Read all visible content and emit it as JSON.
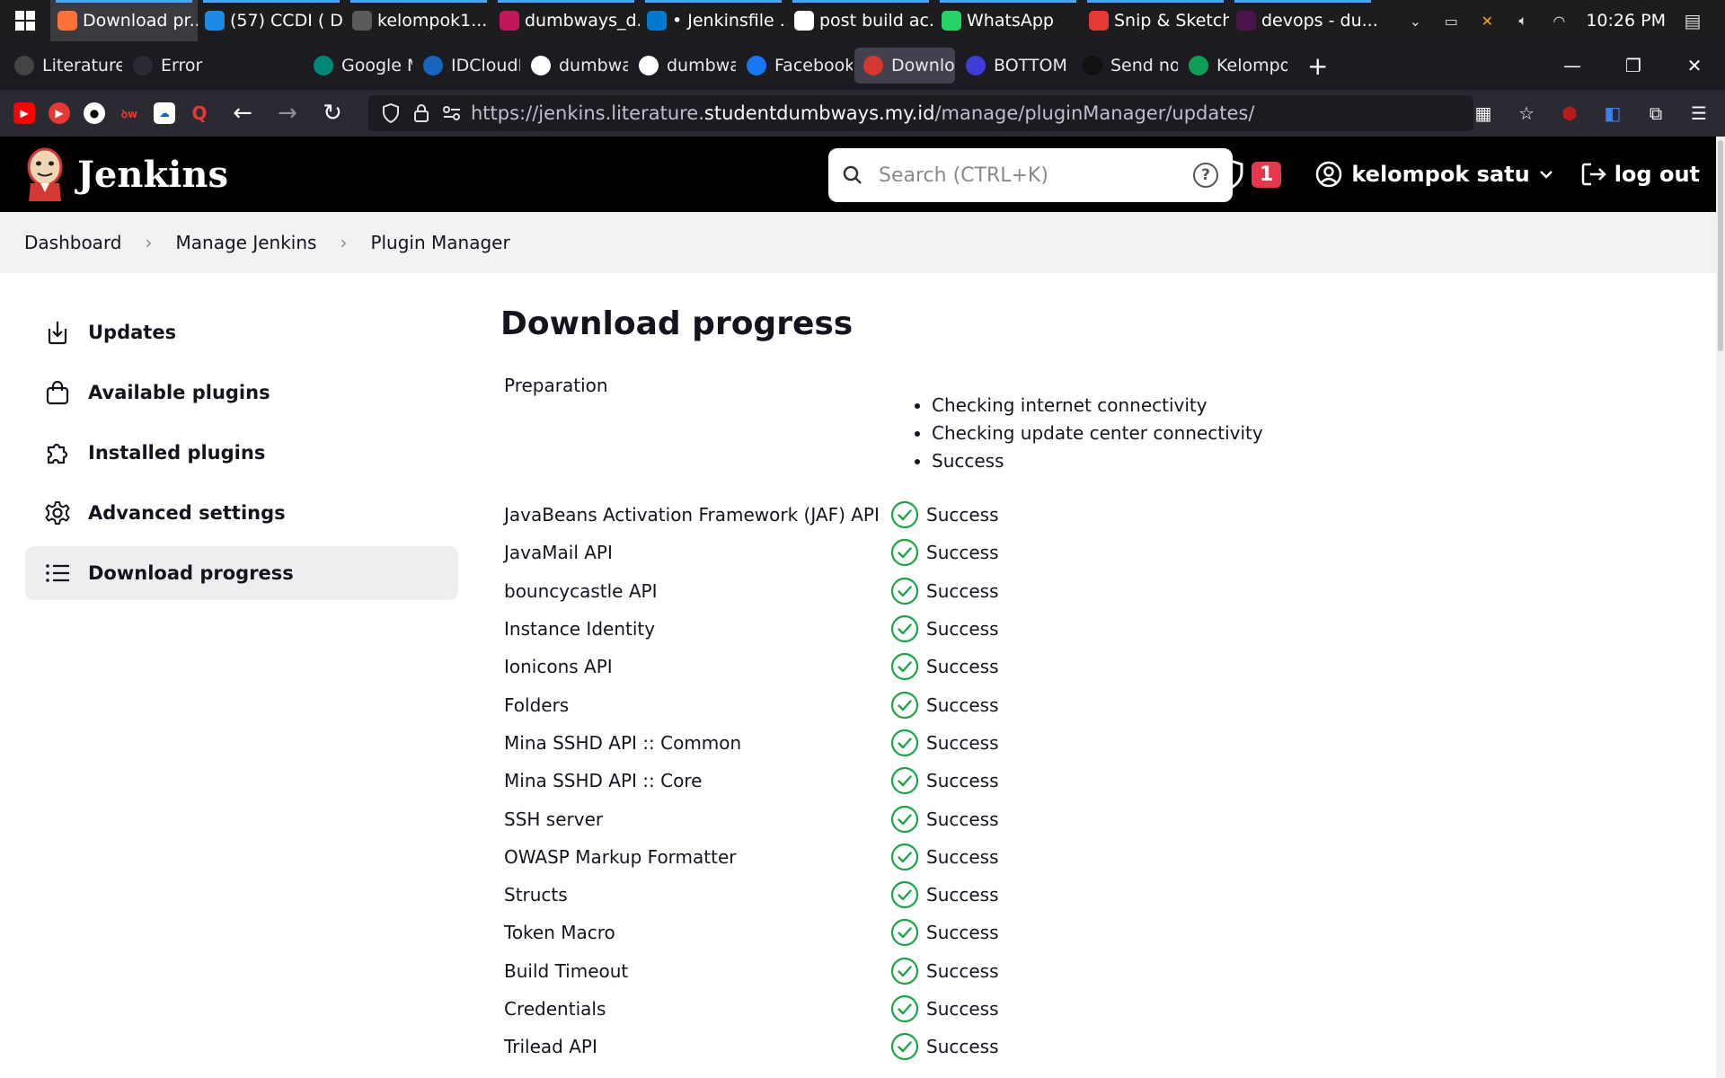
{
  "taskbar": {
    "apps": [
      {
        "label": "Download pr...",
        "color": "#ff7139",
        "active": true
      },
      {
        "label": "(57) CCDI ( D...",
        "color": "#1e88e5",
        "active": false
      },
      {
        "label": "kelompok1...",
        "color": "#5a5a5a",
        "active": false
      },
      {
        "label": "dumbways_d...",
        "color": "#c2185b",
        "active": false
      },
      {
        "label": "• Jenkinsfile ...",
        "color": "#007acc",
        "active": false
      },
      {
        "label": "post build ac...",
        "color": "#ffffff",
        "active": false
      },
      {
        "label": "WhatsApp",
        "color": "#25d366",
        "active": false
      },
      {
        "label": "Snip & Sketch",
        "color": "#e53935",
        "active": false
      },
      {
        "label": "devops - du...",
        "color": "#4a154b",
        "active": false
      }
    ],
    "clock": "10:26 PM"
  },
  "browser": {
    "tabs": [
      {
        "label": "Literature",
        "color": "#444",
        "icon": "feather-icon"
      },
      {
        "label": "Error",
        "color": "#2b2a33",
        "icon": "blank-icon"
      },
      {
        "label": "Google M",
        "color": "#00897b",
        "icon": "meet-icon"
      },
      {
        "label": "IDCloudH",
        "color": "#1565c0",
        "icon": "cloud-icon"
      },
      {
        "label": "dumbway",
        "color": "#fff",
        "icon": "github-icon"
      },
      {
        "label": "dumbway",
        "color": "#fff",
        "icon": "github-icon"
      },
      {
        "label": "Facebook",
        "color": "#1877f2",
        "icon": "facebook-icon"
      },
      {
        "label": "Downlo",
        "color": "#d33833",
        "icon": "jenkins-icon",
        "active": true
      },
      {
        "label": "BOTTOM",
        "color": "#3d3dd8",
        "icon": "d-icon"
      },
      {
        "label": "Send noti",
        "color": "#111",
        "icon": "triangle-icon"
      },
      {
        "label": "Kelompo",
        "color": "#0f9d58",
        "icon": "sheets-icon"
      }
    ],
    "url_prefix": "https://jenkins.literature.",
    "url_host": "studentdumbways.my.id",
    "url_path": "/manage/pluginManager/updates/"
  },
  "jenkins": {
    "brand": "Jenkins",
    "search_placeholder": "Search (CTRL+K)",
    "help_symbol": "?",
    "alert_count": "1",
    "username": "kelompok satu",
    "logout_label": "log out"
  },
  "breadcrumb": [
    "Dashboard",
    "Manage Jenkins",
    "Plugin Manager"
  ],
  "sidebar": {
    "items": [
      {
        "label": "Updates",
        "icon": "download-icon"
      },
      {
        "label": "Available plugins",
        "icon": "shopping-bag-icon"
      },
      {
        "label": "Installed plugins",
        "icon": "puzzle-icon"
      },
      {
        "label": "Advanced settings",
        "icon": "gear-icon"
      },
      {
        "label": "Download progress",
        "icon": "list-icon",
        "active": true
      }
    ]
  },
  "main": {
    "title": "Download progress",
    "preparation_label": "Preparation",
    "preparation_steps": [
      "Checking internet connectivity",
      "Checking update center connectivity",
      "Success"
    ],
    "plugins": [
      {
        "name": "JavaBeans Activation Framework (JAF) API",
        "status": "Success"
      },
      {
        "name": "JavaMail API",
        "status": "Success"
      },
      {
        "name": "bouncycastle API",
        "status": "Success"
      },
      {
        "name": "Instance Identity",
        "status": "Success"
      },
      {
        "name": "Ionicons API",
        "status": "Success"
      },
      {
        "name": "Folders",
        "status": "Success"
      },
      {
        "name": "Mina SSHD API :: Common",
        "status": "Success"
      },
      {
        "name": "Mina SSHD API :: Core",
        "status": "Success"
      },
      {
        "name": "SSH server",
        "status": "Success"
      },
      {
        "name": "OWASP Markup Formatter",
        "status": "Success"
      },
      {
        "name": "Structs",
        "status": "Success"
      },
      {
        "name": "Token Macro",
        "status": "Success"
      },
      {
        "name": "Build Timeout",
        "status": "Success"
      },
      {
        "name": "Credentials",
        "status": "Success"
      },
      {
        "name": "Trilead API",
        "status": "Success"
      }
    ]
  },
  "colors": {
    "success_green": "#1ea446",
    "alert_red": "#e6384b",
    "header_bg": "#000000"
  }
}
